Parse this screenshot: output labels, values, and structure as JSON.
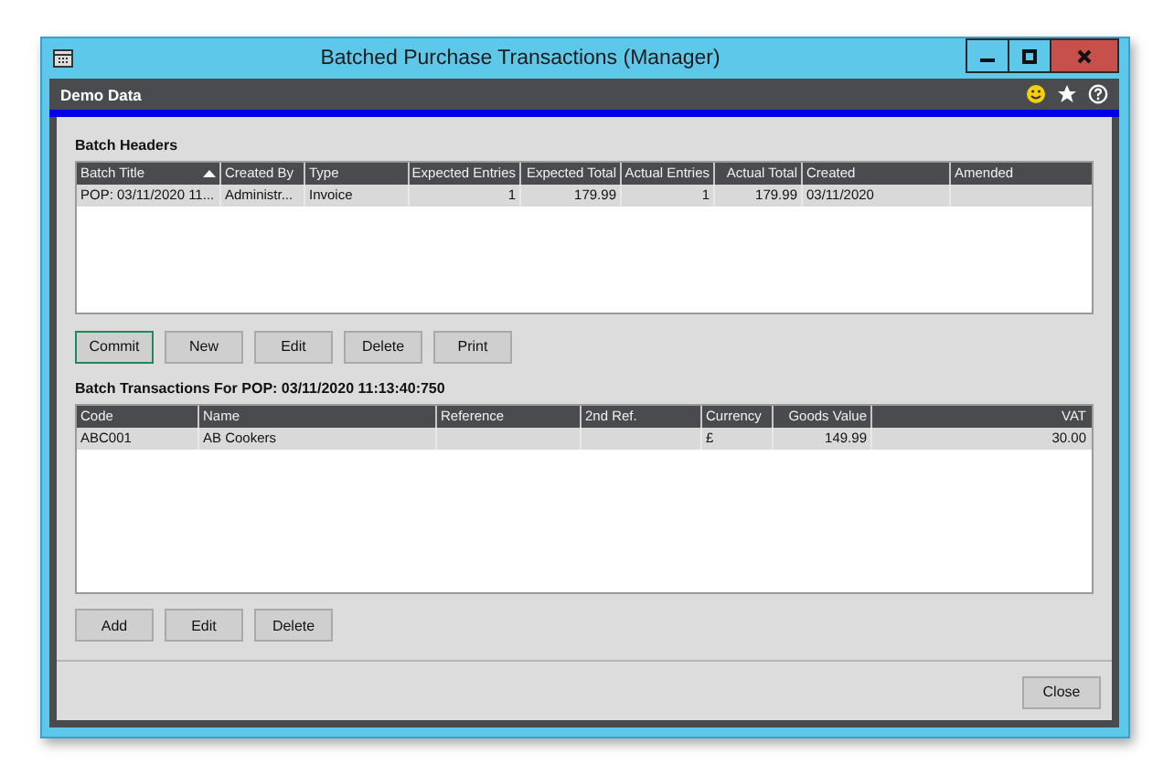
{
  "window": {
    "title": "Batched Purchase Transactions (Manager)"
  },
  "header": {
    "company": "Demo Data"
  },
  "batch_headers": {
    "title": "Batch Headers",
    "columns": [
      {
        "label": "Batch Title",
        "right_aligned": false,
        "sorted": true
      },
      {
        "label": "Created By",
        "right_aligned": false,
        "sorted": false
      },
      {
        "label": "Type",
        "right_aligned": false,
        "sorted": false
      },
      {
        "label": "Expected Entries",
        "right_aligned": true,
        "sorted": false
      },
      {
        "label": "Expected Total",
        "right_aligned": true,
        "sorted": false
      },
      {
        "label": "Actual Entries",
        "right_aligned": true,
        "sorted": false
      },
      {
        "label": "Actual Total",
        "right_aligned": true,
        "sorted": false
      },
      {
        "label": "Created",
        "right_aligned": false,
        "sorted": false
      },
      {
        "label": "Amended",
        "right_aligned": false,
        "sorted": false
      }
    ],
    "rows": [
      {
        "selected": true,
        "cells": [
          "POP: 03/11/2020 11...",
          "Administr...",
          "Invoice",
          "1",
          "179.99",
          "1",
          "179.99",
          "03/11/2020",
          ""
        ]
      }
    ]
  },
  "batch_buttons": [
    {
      "label": "Commit",
      "focused": true
    },
    {
      "label": "New",
      "focused": false
    },
    {
      "label": "Edit",
      "focused": false
    },
    {
      "label": "Delete",
      "focused": false
    },
    {
      "label": "Print",
      "focused": false
    }
  ],
  "batch_transactions": {
    "title": "Batch Transactions For POP: 03/11/2020 11:13:40:750",
    "columns": [
      {
        "label": "Code",
        "right_aligned": false,
        "sorted": false
      },
      {
        "label": "Name",
        "right_aligned": false,
        "sorted": false
      },
      {
        "label": "Reference",
        "right_aligned": false,
        "sorted": false
      },
      {
        "label": "2nd Ref.",
        "right_aligned": false,
        "sorted": false
      },
      {
        "label": "Currency",
        "right_aligned": false,
        "sorted": false
      },
      {
        "label": "Goods Value",
        "right_aligned": true,
        "sorted": false
      },
      {
        "label": "VAT",
        "right_aligned": true,
        "sorted": false
      }
    ],
    "rows": [
      {
        "selected": true,
        "cells": [
          "ABC001",
          "AB Cookers",
          "",
          "",
          "£",
          "149.99",
          "30.00"
        ]
      }
    ]
  },
  "transaction_buttons": [
    {
      "label": "Add",
      "focused": false
    },
    {
      "label": "Edit",
      "focused": false
    },
    {
      "label": "Delete",
      "focused": false
    }
  ],
  "footer_buttons": [
    {
      "label": "Close",
      "focused": false
    }
  ]
}
